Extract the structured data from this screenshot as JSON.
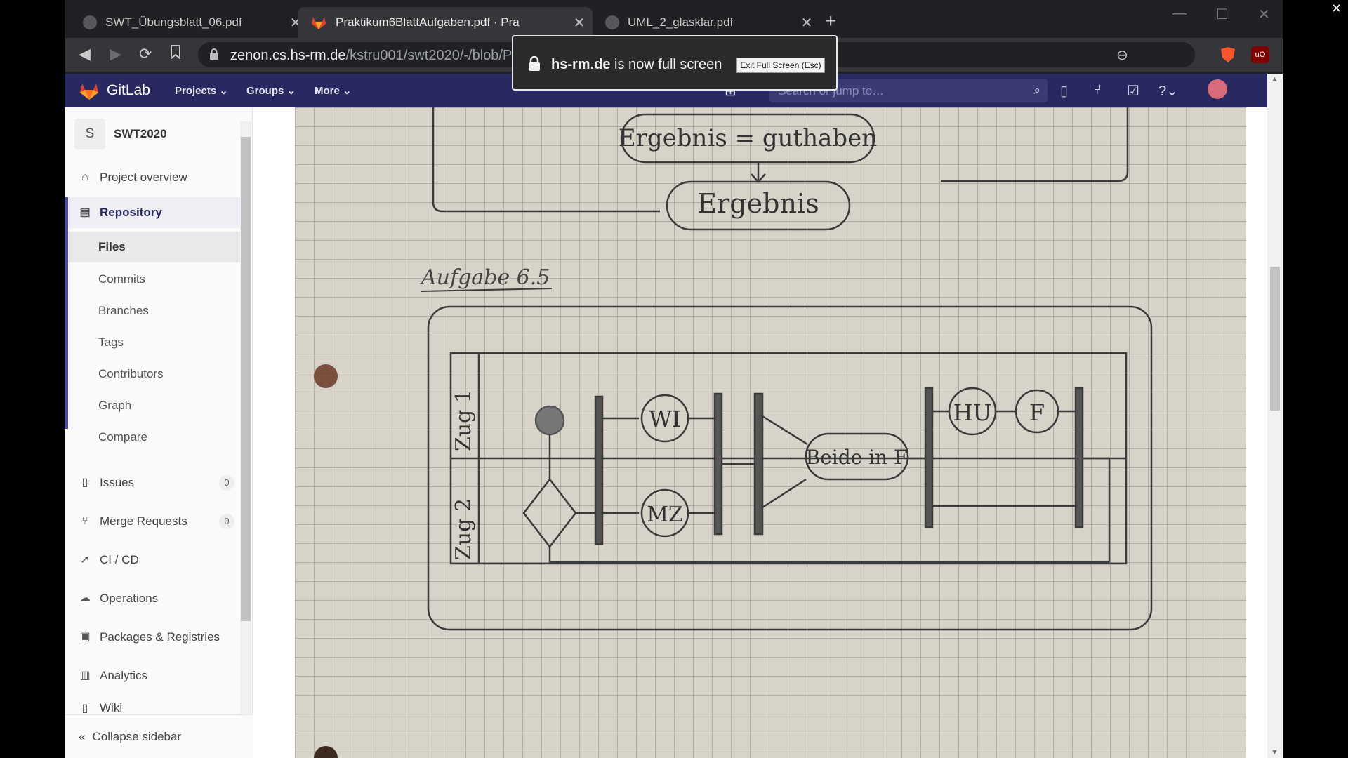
{
  "browser": {
    "tabs": [
      {
        "title": "SWT_Übungsblatt_06.pdf",
        "icon": "globe-icon"
      },
      {
        "title": "Praktikum6BlattAufgaben.pdf · Pra",
        "icon": "gitlab-icon"
      },
      {
        "title": "UML_2_glasklar.pdf",
        "icon": "globe-icon"
      }
    ],
    "url_domain": "zenon.cs.hs-rm.de",
    "url_path": "/kstru001/swt2020/-/blob/Pra"
  },
  "fullscreen_notice": {
    "domain": "hs-rm.de",
    "message": "is now full screen",
    "exit_button": "Exit Full Screen (Esc)"
  },
  "gitlab": {
    "brand": "GitLab",
    "menu": [
      "Projects",
      "Groups",
      "More"
    ],
    "search_placeholder": "Search or jump to…",
    "accent": "#292961"
  },
  "sidebar": {
    "project_initial": "S",
    "project_name": "SWT2020",
    "overview": "Project overview",
    "repository": "Repository",
    "repo_sub": [
      "Files",
      "Commits",
      "Branches",
      "Tags",
      "Contributors",
      "Graph",
      "Compare"
    ],
    "issues": "Issues",
    "issues_count": "0",
    "merge_requests": "Merge Requests",
    "mr_count": "0",
    "cicd": "CI / CD",
    "operations": "Operations",
    "packages": "Packages & Registries",
    "analytics": "Analytics",
    "wiki": "Wiki",
    "collapse": "Collapse sidebar"
  },
  "document": {
    "labels": {
      "ergebnis_guthaben": "Ergebnis = guthaben",
      "ergebnis": "Ergebnis",
      "heading": "Aufgabe 6.5",
      "lane1": "Zug 1",
      "lane2": "Zug 2",
      "wi": "WI",
      "mz": "MZ",
      "beide": "Beide in F",
      "hu": "HU",
      "f": "F"
    }
  }
}
